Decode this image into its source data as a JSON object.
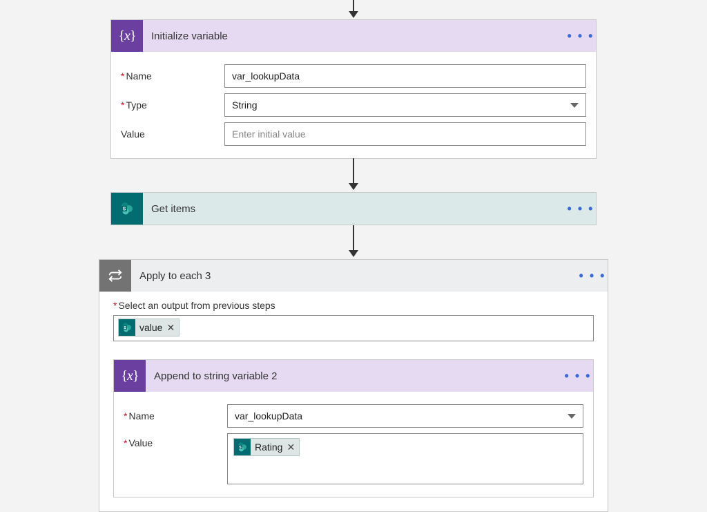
{
  "arrows": {
    "count": 4
  },
  "card1": {
    "title": "Initialize variable",
    "fields": {
      "name": {
        "label": "Name",
        "value": "var_lookupData",
        "required": true
      },
      "type": {
        "label": "Type",
        "value": "String",
        "required": true
      },
      "value": {
        "label": "Value",
        "placeholder": "Enter initial value",
        "required": false
      }
    }
  },
  "card2": {
    "title": "Get items"
  },
  "card3": {
    "title": "Apply to each 3",
    "select_label": "Select an output from previous steps",
    "token_value": "value",
    "inner": {
      "title": "Append to string variable 2",
      "fields": {
        "name": {
          "label": "Name",
          "value": "var_lookupData",
          "required": true
        },
        "value": {
          "label": "Value",
          "token": "Rating",
          "required": true
        }
      }
    }
  },
  "glyphs": {
    "ellipsis": "• • •",
    "remove": "✕"
  }
}
